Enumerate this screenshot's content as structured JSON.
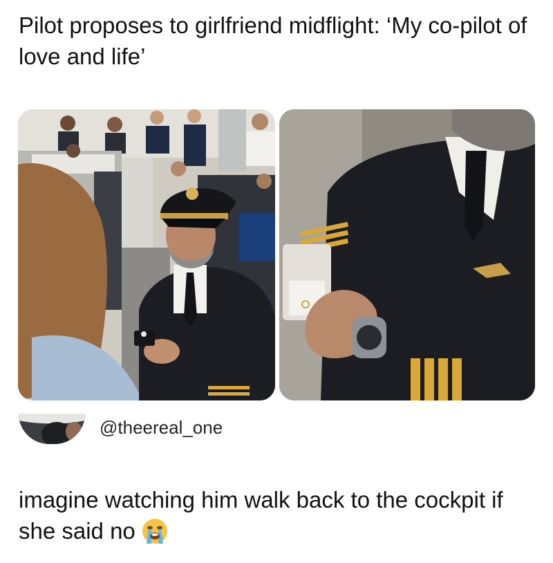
{
  "post": {
    "headline": "Pilot proposes to girlfriend midflight: ‘My co-pilot of love and life’",
    "photos": [
      {
        "icon": "photo-pilot-kneeling-proposal"
      },
      {
        "icon": "photo-pilot-holding-ring-box"
      }
    ]
  },
  "author": {
    "handle": "@theereal_one",
    "avatar_icon": "avatar-icon"
  },
  "tweet": {
    "text": "imagine watching him walk back to the cockpit if she said no",
    "emoji": "loudly-crying-face-emoji"
  },
  "colors": {
    "text": "#111111",
    "uniform": "#1c1d22",
    "gold": "#d8a93a"
  }
}
